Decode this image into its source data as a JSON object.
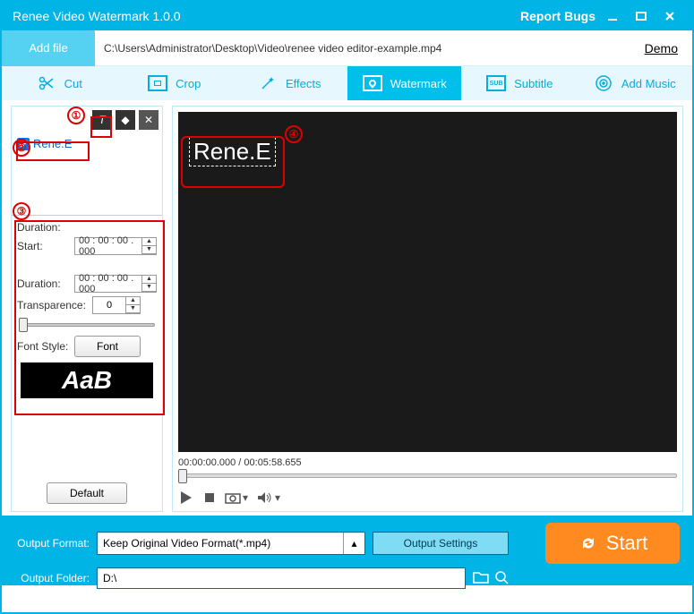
{
  "titlebar": {
    "title": "Renee Video Watermark 1.0.0",
    "report": "Report Bugs"
  },
  "filerow": {
    "addfile": "Add file",
    "path": "C:\\Users\\Administrator\\Desktop\\Video\\renee video editor-example.mp4",
    "demo": "Demo"
  },
  "tabs": {
    "cut": "Cut",
    "crop": "Crop",
    "effects": "Effects",
    "watermark": "Watermark",
    "subtitle": "Subtitle",
    "addmusic": "Add Music"
  },
  "leftpanel": {
    "item": "Rene.E",
    "duration_label": "Duration:",
    "start_label": "Start:",
    "start_value": "00 : 00 : 00 . 000",
    "duration2_label": "Duration:",
    "duration2_value": "00 : 00 : 00 . 000",
    "trans_label": "Transparence:",
    "trans_value": "0",
    "fontstyle_label": "Font Style:",
    "font_btn": "Font",
    "font_preview": "AaB",
    "default_btn": "Default"
  },
  "video": {
    "wm_text": "Rene.E",
    "timecode": "00:00:00.000 / 00:05:58.655"
  },
  "bottom": {
    "outformat_label": "Output Format:",
    "outformat_value": "Keep Original Video Format(*.mp4)",
    "outsettings": "Output Settings",
    "start": "Start",
    "outfolder_label": "Output Folder:",
    "outfolder_value": "D:\\"
  },
  "annotations": {
    "a1": "①",
    "a2": "②",
    "a3": "③",
    "a4": "④"
  }
}
